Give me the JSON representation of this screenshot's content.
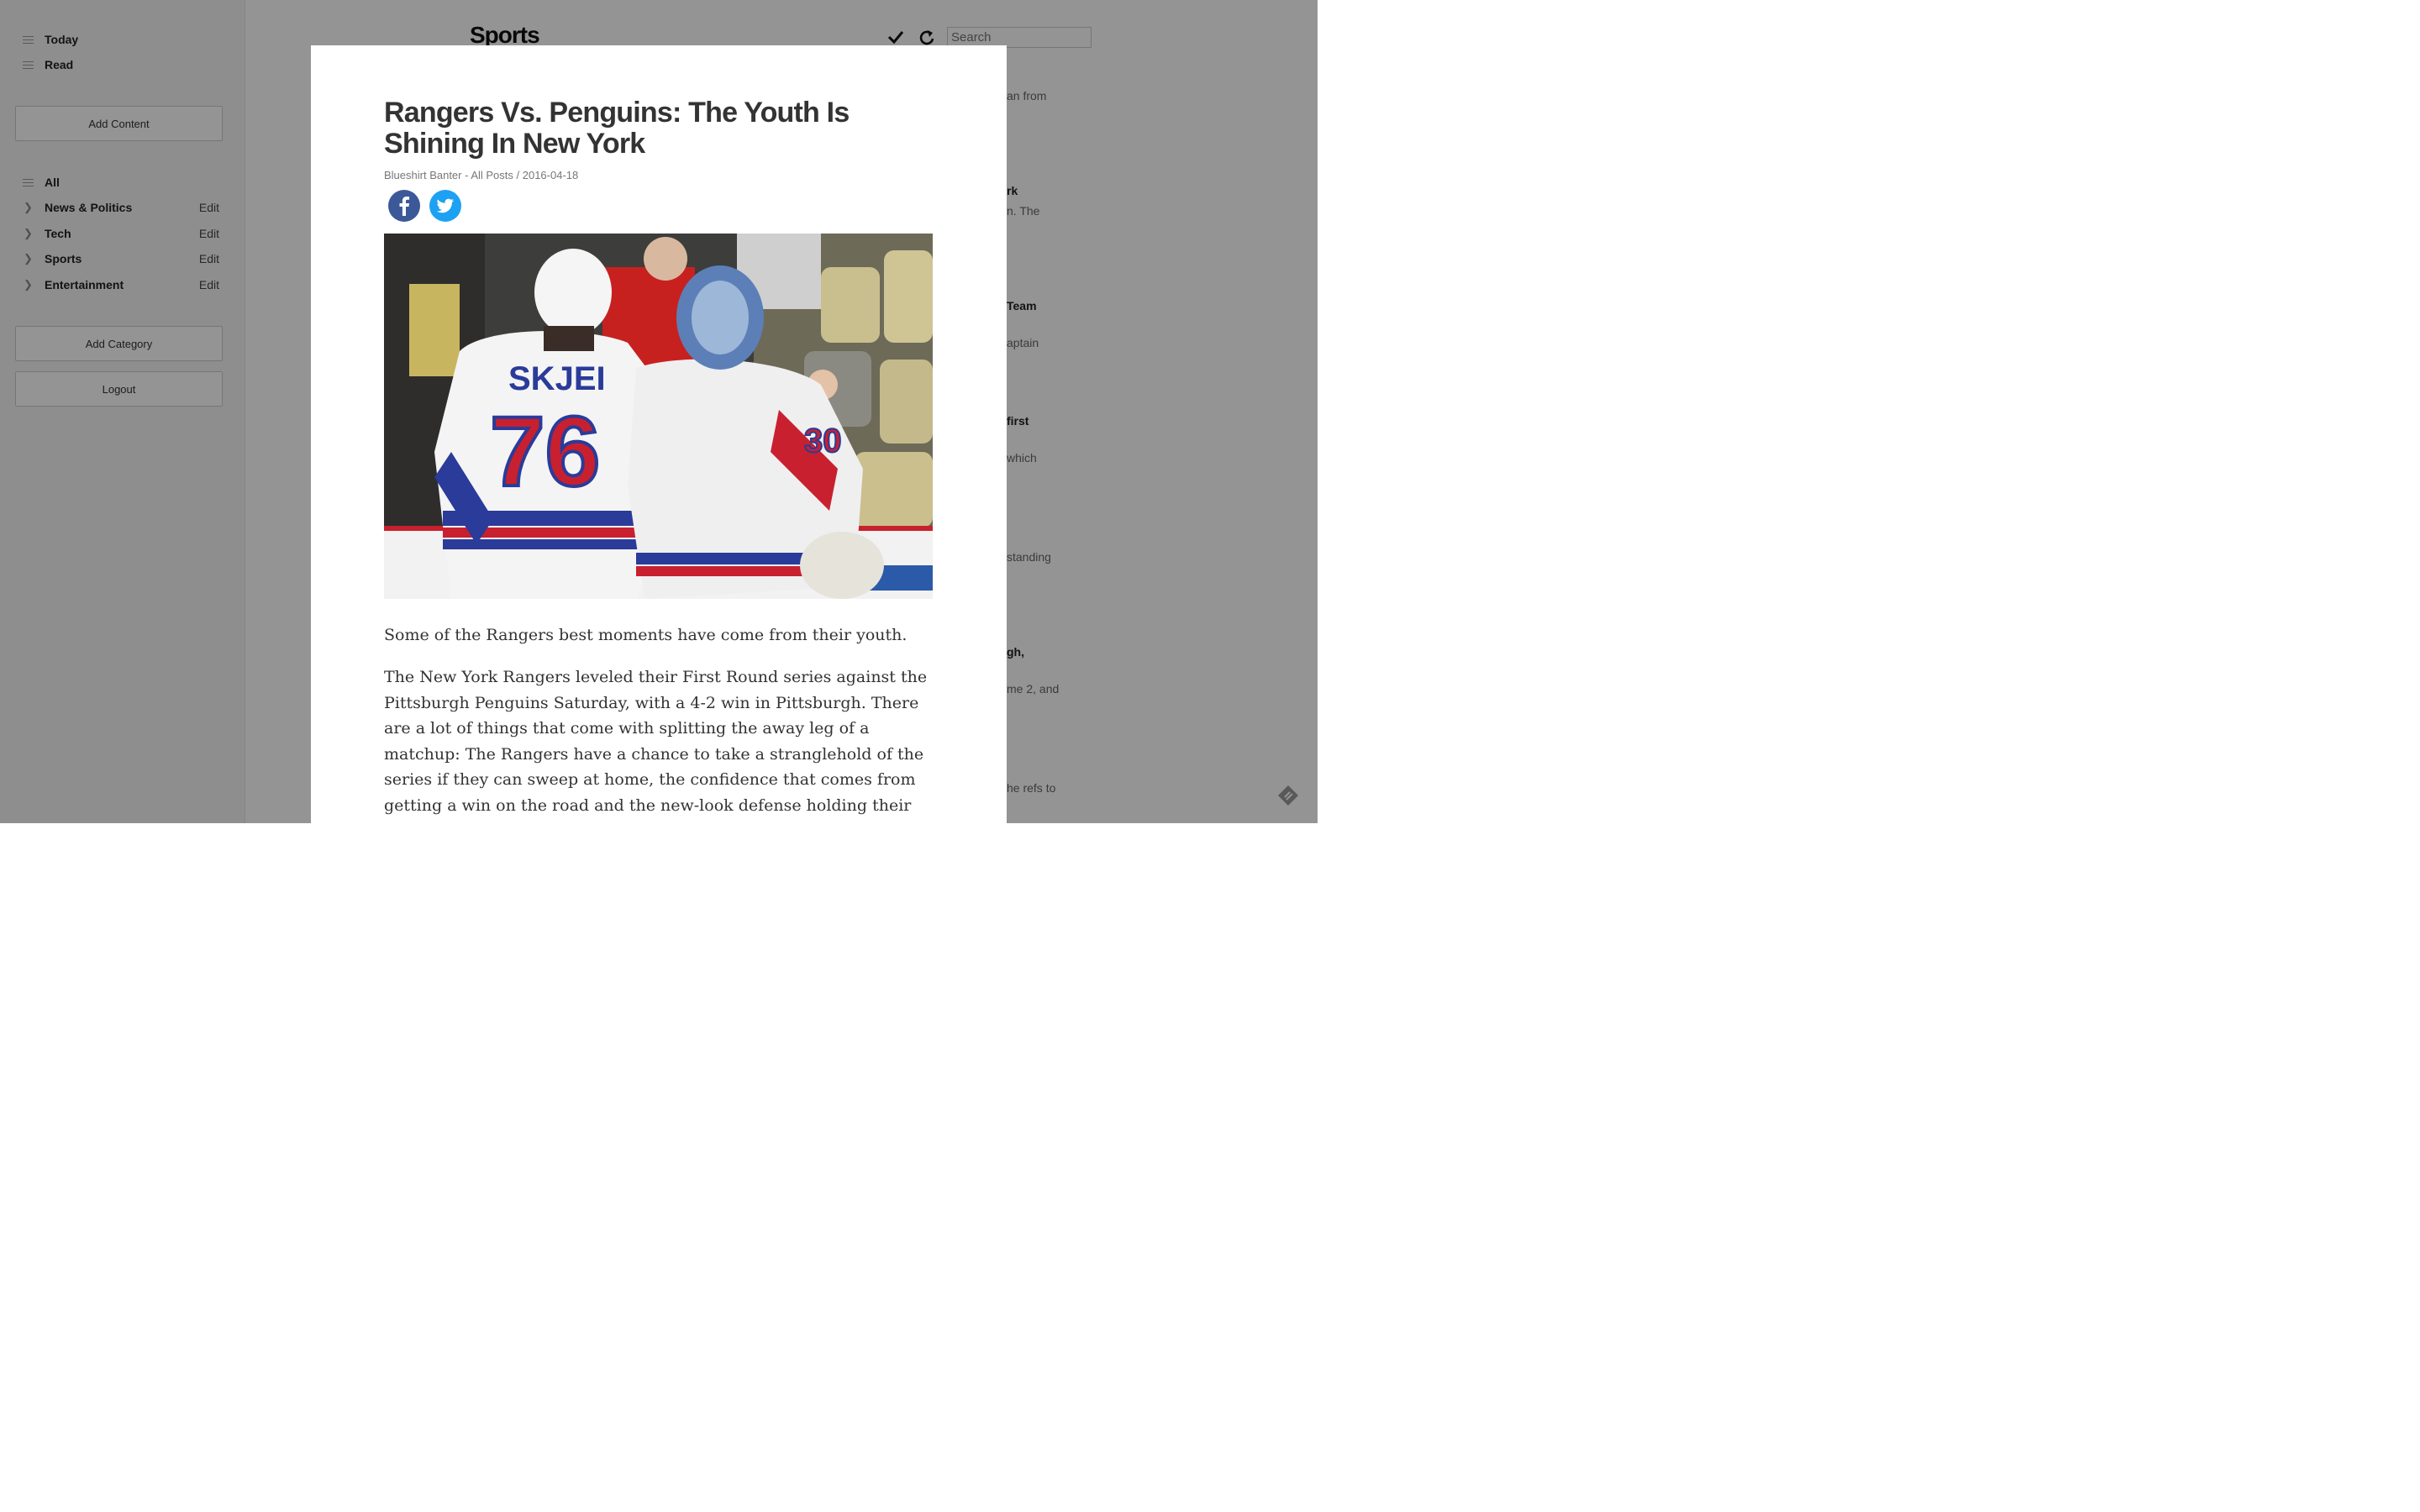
{
  "sidebar": {
    "top_items": [
      {
        "label": "Today",
        "icon": "hamburger-icon"
      },
      {
        "label": "Read",
        "icon": "hamburger-icon"
      }
    ],
    "add_content_label": "Add Content",
    "all_label": "All",
    "categories": [
      {
        "label": "News & Politics",
        "edit": "Edit"
      },
      {
        "label": "Tech",
        "edit": "Edit"
      },
      {
        "label": "Sports",
        "edit": "Edit"
      },
      {
        "label": "Entertainment",
        "edit": "Edit"
      }
    ],
    "add_category_label": "Add Category",
    "logout_label": "Logout"
  },
  "header": {
    "title": "Sports",
    "search_placeholder": "Search",
    "icons": [
      "check-icon",
      "refresh-icon"
    ]
  },
  "background_peek": [
    "an from",
    "rk",
    "n. The",
    "Team",
    "aptain",
    "first",
    "which",
    "standing",
    "gh,",
    "me 2, and",
    "he refs to"
  ],
  "article": {
    "title": "Rangers Vs. Penguins: The Youth Is Shining In New York",
    "meta": "Blueshirt Banter - All Posts / 2016-04-18",
    "share": [
      "facebook-icon",
      "twitter-icon"
    ],
    "image": {
      "jersey_name": "SKJEI",
      "jersey_number": "76",
      "goalie_number": "30"
    },
    "paragraphs": [
      "Some of the Rangers best moments have come from their youth.",
      "The New York Rangers leveled their First Round series against the Pittsburgh Penguins Saturday, with a 4-2 win in Pittsburgh. There are a lot of things that come with splitting the away leg of a matchup: The Rangers have a chance to take a stranglehold of the series if they can sweep at home, the confidence that comes from getting a win on the road and the new-look defense holding their own against a strengthened Penguins"
    ]
  },
  "colors": {
    "facebook": "#3b5998",
    "twitter": "#1da1f2",
    "rangers_blue": "#2a3b9a",
    "rangers_red": "#c8202f"
  }
}
